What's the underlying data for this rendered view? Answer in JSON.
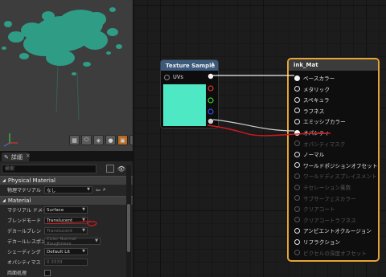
{
  "viewport": {
    "toolbar": [
      {
        "name": "grid-icon",
        "glyph": "▦"
      },
      {
        "name": "cylinder-icon",
        "glyph": "⬭"
      },
      {
        "name": "plane-icon",
        "glyph": "◈"
      },
      {
        "name": "sphere-icon",
        "glyph": "●"
      },
      {
        "name": "box-icon",
        "glyph": "▣"
      },
      {
        "name": "teapot-icon",
        "glyph": "♨"
      }
    ],
    "axis_label": "y"
  },
  "details": {
    "tab_label": "詳細",
    "search_placeholder": "検索",
    "sections": {
      "physical": "Physical Material",
      "material": "Material"
    },
    "physical_row": {
      "label": "物理マテリアル",
      "value": "なし"
    },
    "rows": [
      {
        "label": "マテリアル ドメイン",
        "value": "Surface",
        "dim": false
      },
      {
        "label": "ブレンドモード",
        "value": "Translucent",
        "dim": false
      },
      {
        "label": "デカールブレン",
        "value": "Translucent",
        "dim": true
      },
      {
        "label": "デカールレスポン",
        "value": "Color Normal Roughness",
        "dim": true
      },
      {
        "label": "シェーディング",
        "value": "Default Lit",
        "dim": false
      },
      {
        "label": "オパシティマス",
        "value": "0.3333",
        "dim": true
      },
      {
        "label": "両面処理",
        "value": "",
        "dim": false
      }
    ]
  },
  "texture_node": {
    "title": "Texture Sample",
    "uv_label": "UVs",
    "preview_color": "#4fe8c4"
  },
  "material_node": {
    "title": "ink_Mat",
    "pins": [
      {
        "label": "ベースカラー",
        "enabled": true,
        "filled": true
      },
      {
        "label": "メタリック",
        "enabled": true,
        "filled": false
      },
      {
        "label": "スペキュラ",
        "enabled": true,
        "filled": false
      },
      {
        "label": "ラフネス",
        "enabled": true,
        "filled": false
      },
      {
        "label": "エミッシブカラー",
        "enabled": true,
        "filled": false
      },
      {
        "label": "オパシティ",
        "enabled": true,
        "filled": true
      },
      {
        "label": "オパシティマスク",
        "enabled": false,
        "filled": false
      },
      {
        "label": "ノーマル",
        "enabled": true,
        "filled": false
      },
      {
        "label": "ワールドポジションオフセット",
        "enabled": true,
        "filled": false
      },
      {
        "label": "ワールドディスプレイスメント",
        "enabled": false,
        "filled": false
      },
      {
        "label": "テセレーション乗数",
        "enabled": false,
        "filled": false
      },
      {
        "label": "サブサーフェスカラー",
        "enabled": false,
        "filled": false
      },
      {
        "label": "クリアコート",
        "enabled": false,
        "filled": false
      },
      {
        "label": "クリアコートラフネス",
        "enabled": false,
        "filled": false
      },
      {
        "label": "アンビエントオクルージョン",
        "enabled": true,
        "filled": false
      },
      {
        "label": "リフラクション",
        "enabled": true,
        "filled": false
      },
      {
        "label": "ピクセルの深度オフセット",
        "enabled": false,
        "filled": false
      }
    ]
  },
  "colors": {
    "accent_selection": "#e7a534",
    "annotation_red": "#d6181c",
    "splat": "#2f9c86"
  }
}
